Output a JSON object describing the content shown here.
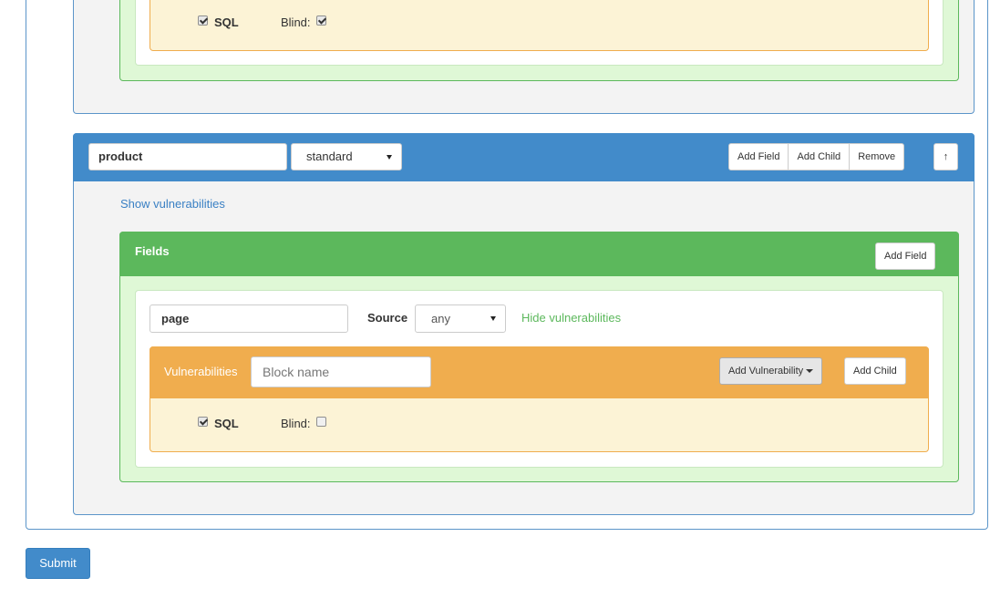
{
  "previous_block": {
    "vulnerabilities": [
      {
        "name": "SQL",
        "checked": true,
        "blind_label": "Blind:",
        "blind_checked": true
      }
    ]
  },
  "product_block": {
    "name_value": "product",
    "type_value": "standard",
    "buttons": {
      "add_field": "Add Field",
      "add_child": "Add Child",
      "remove": "Remove",
      "move_up": "↑"
    },
    "show_vulnerabilities": "Show vulnerabilities",
    "fields_panel": {
      "title": "Fields",
      "add_field": "Add Field",
      "field": {
        "name_value": "page",
        "source_label": "Source",
        "source_value": "any",
        "hide_vulnerabilities": "Hide vulnerabilities",
        "vulnerabilities": {
          "label": "Vulnerabilities",
          "block_name_placeholder": "Block name",
          "add_vulnerability": "Add Vulnerability",
          "add_child": "Add Child",
          "items": [
            {
              "name": "SQL",
              "checked": true,
              "blind_label": "Blind:",
              "blind_checked": false
            }
          ]
        }
      }
    }
  },
  "submit_label": "Submit"
}
